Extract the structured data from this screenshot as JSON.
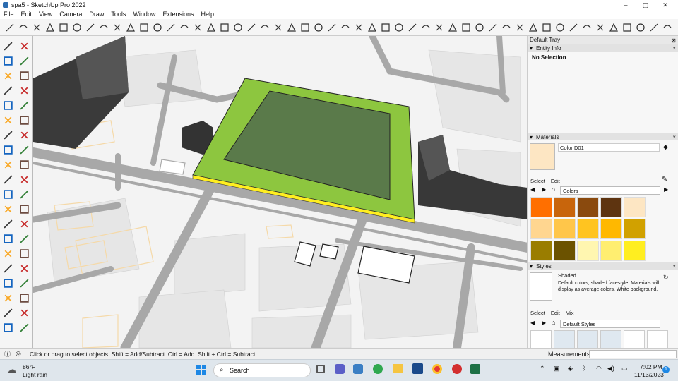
{
  "window": {
    "title": "spa5 - SketchUp Pro 2022",
    "controls": [
      "–",
      "▢",
      "✕"
    ]
  },
  "menu": [
    "File",
    "Edit",
    "View",
    "Camera",
    "Draw",
    "Tools",
    "Window",
    "Extensions",
    "Help"
  ],
  "tray": {
    "title": "Default Tray",
    "entity_info": {
      "header": "Entity Info",
      "text": "No Selection"
    },
    "materials": {
      "header": "Materials",
      "current": "Color D01",
      "tabs": [
        "Select",
        "Edit"
      ],
      "library": "Colors",
      "swatches": [
        "#ff6f00",
        "#c8650c",
        "#8a4a0e",
        "#5e3410",
        "#fde6c3",
        "#ffd690",
        "#ffc64a",
        "#ffc420",
        "#ffb800",
        "#d1a100",
        "#9a7d00",
        "#6b5200",
        "#fff6b0",
        "#ffee70",
        "#ffee20"
      ]
    },
    "styles": {
      "header": "Styles",
      "name": "Shaded",
      "description": "Default colors, shaded facestyle. Materials will display as average colors.  White background.",
      "tabs": [
        "Select",
        "Edit",
        "Mix"
      ],
      "library": "Default Styles"
    }
  },
  "status": {
    "text": "Click or drag to select objects. Shift = Add/Subtract. Ctrl = Add. Shift + Ctrl = Subtract.",
    "measurements": "Measurements"
  },
  "taskbar": {
    "weather_temp": "86°F",
    "weather_text": "Light rain",
    "search": "Search",
    "time": "7:02 PM",
    "date": "11/13/2023",
    "notif": "1"
  },
  "colors": {
    "accent_green": "#8dc63f",
    "dark_green": "#5a7a4a",
    "building": "#3a3a3a",
    "road": "#a9a9a9"
  }
}
